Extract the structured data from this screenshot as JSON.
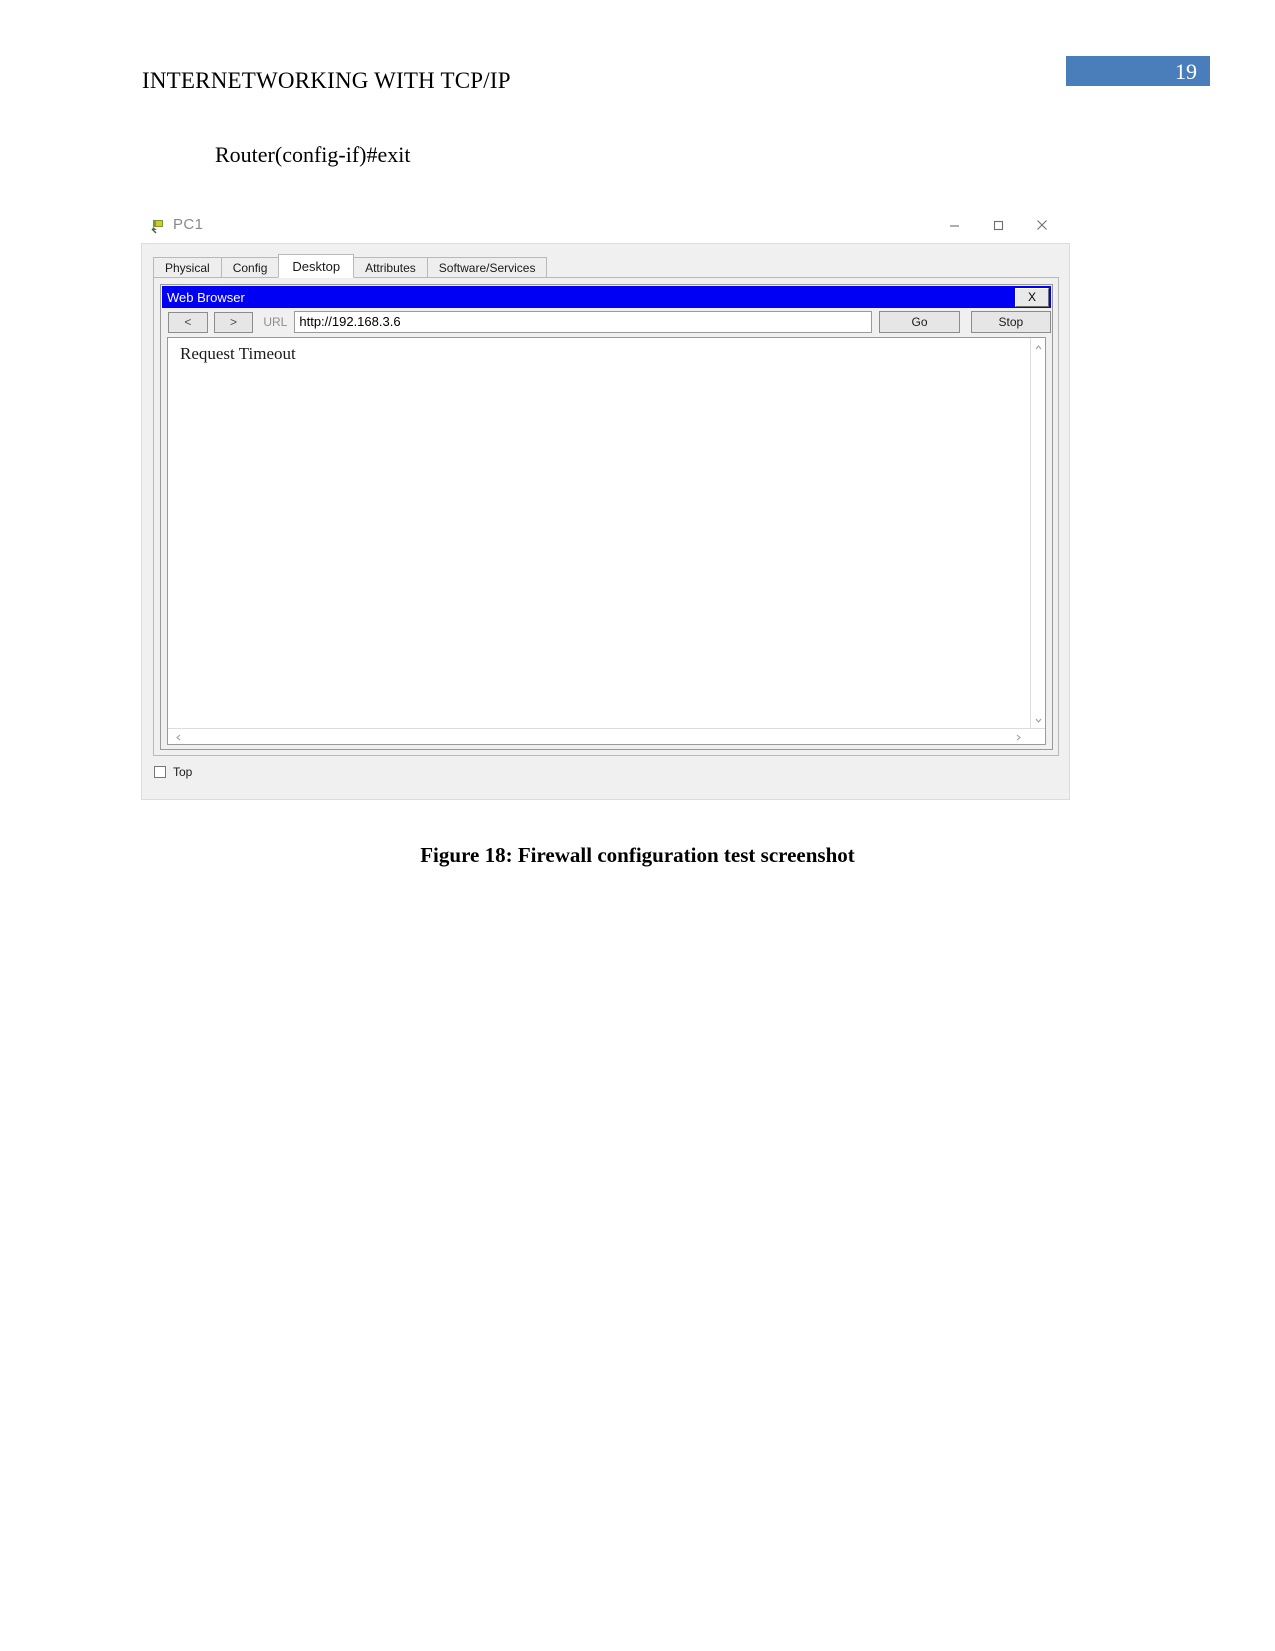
{
  "document": {
    "header_title": "INTERNETWORKING WITH TCP/IP",
    "page_number": "19",
    "page_badge_color": "#4a7ebb",
    "command_line": "Router(config-if)#exit",
    "figure_caption": "Figure 18: Firewall configuration test screenshot"
  },
  "pt_window": {
    "title": "PC1",
    "title_icon": "packet-tracer-pc-icon",
    "window_buttons": {
      "minimize": "minimize-icon",
      "maximize": "maximize-icon",
      "close": "close-icon"
    },
    "tabs": [
      {
        "label": "Physical",
        "active": false
      },
      {
        "label": "Config",
        "active": false
      },
      {
        "label": "Desktop",
        "active": true
      },
      {
        "label": "Attributes",
        "active": false
      },
      {
        "label": "Software/Services",
        "active": false
      }
    ],
    "top_checkbox": {
      "label": "Top",
      "checked": false
    }
  },
  "web_browser": {
    "title": "Web Browser",
    "title_bar_color": "#0000f5",
    "close_button": "X",
    "back_button": "<",
    "forward_button": ">",
    "url_label": "URL",
    "url_value": "http://192.168.3.6",
    "url_placeholder": "http://",
    "go_button": "Go",
    "stop_button": "Stop",
    "content_text": "Request Timeout",
    "scroll_up_icon": "chevron-up-icon",
    "scroll_down_icon": "chevron-down-icon",
    "scroll_left_icon": "chevron-left-icon",
    "scroll_right_icon": "chevron-right-icon"
  }
}
